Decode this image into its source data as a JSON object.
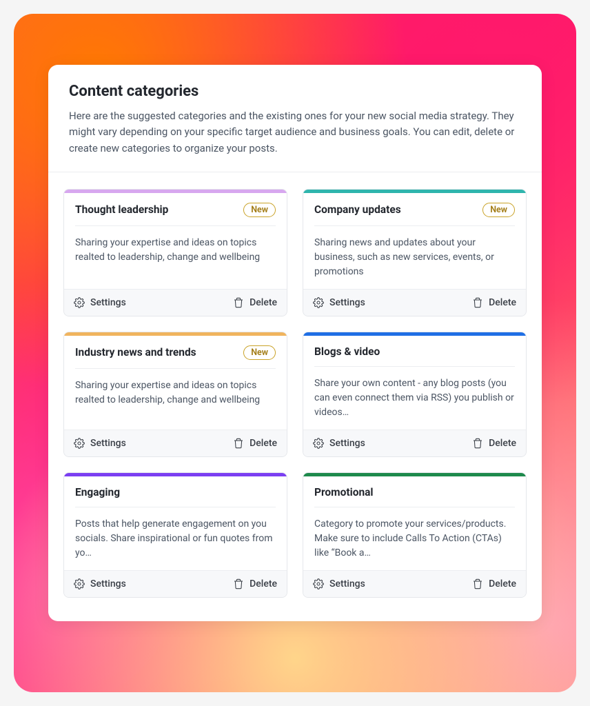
{
  "header": {
    "title": "Content categories",
    "description": "Here are the suggested categories and the existing ones for your new social media strategy. They might vary depending on your specific target audience and business goals. You can edit, delete or create new categories to organize your posts."
  },
  "badge_label": "New",
  "actions": {
    "settings": "Settings",
    "delete": "Delete"
  },
  "colors": {
    "accent0": "#d7a7ef",
    "accent1": "#2fb5ad",
    "accent2": "#f0b45e",
    "accent3": "#1f6fe5",
    "accent4": "#7b3ff2",
    "accent5": "#1e8a4c"
  },
  "cards": [
    {
      "title": "Thought leadership",
      "is_new": true,
      "accent": "accent0",
      "desc": "Sharing your expertise and ideas on topics realted to leadership, change and wellbeing"
    },
    {
      "title": "Company updates",
      "is_new": true,
      "accent": "accent1",
      "desc": "Sharing news and updates about your business, such as new services, events, or promotions"
    },
    {
      "title": "Industry news and trends",
      "is_new": true,
      "accent": "accent2",
      "desc": "Sharing your expertise and ideas on topics realted to leadership, change and wellbeing"
    },
    {
      "title": "Blogs & video",
      "is_new": false,
      "accent": "accent3",
      "desc": "Share your own content - any blog posts (you can even connect them via RSS) you publish or videos…"
    },
    {
      "title": "Engaging",
      "is_new": false,
      "accent": "accent4",
      "desc": "Posts that help generate engagement on you socials. Share inspirational or fun quotes from yo…"
    },
    {
      "title": "Promotional",
      "is_new": false,
      "accent": "accent5",
      "desc": "Category to promote your services/products. Make sure to include Calls To Action (CTAs) like “Book a…"
    }
  ]
}
